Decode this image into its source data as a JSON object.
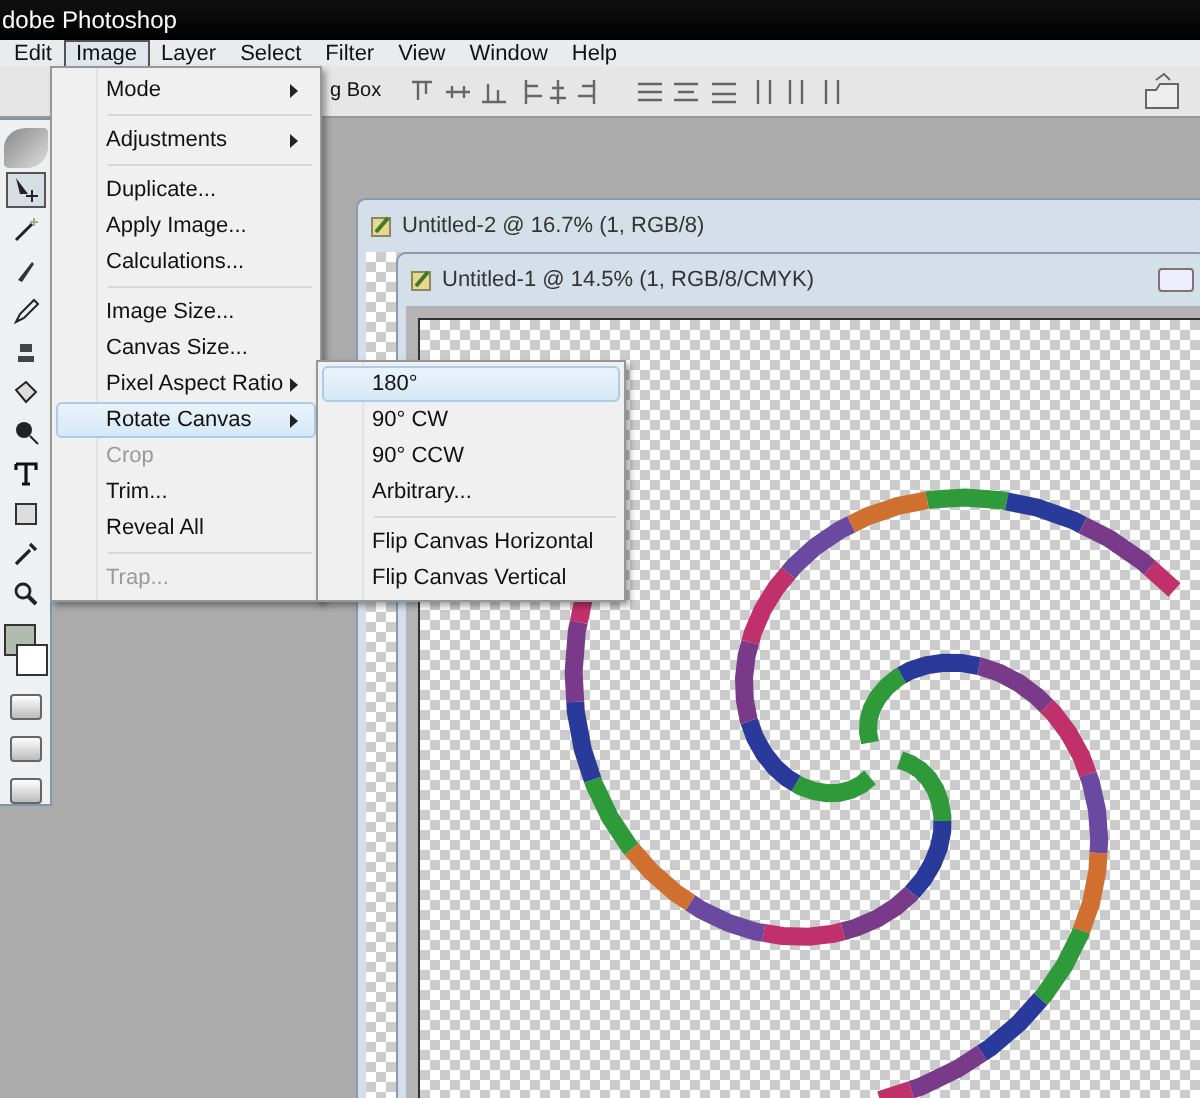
{
  "window": {
    "title": "dobe Photoshop"
  },
  "menubar": [
    {
      "label": "Edit",
      "selected": false
    },
    {
      "label": "Image",
      "selected": true
    },
    {
      "label": "Layer",
      "selected": false
    },
    {
      "label": "Select",
      "selected": false
    },
    {
      "label": "Filter",
      "selected": false
    },
    {
      "label": "View",
      "selected": false
    },
    {
      "label": "Window",
      "selected": false
    },
    {
      "label": "Help",
      "selected": false
    }
  ],
  "options_bar": {
    "label": "g Box"
  },
  "toolbox": [
    {
      "kind": "move",
      "selected": true
    },
    {
      "kind": "wand",
      "selected": false
    },
    {
      "kind": "brush",
      "selected": false
    },
    {
      "kind": "pencil",
      "selected": false
    },
    {
      "kind": "stamp",
      "selected": false
    },
    {
      "kind": "bucket",
      "selected": false
    },
    {
      "kind": "dodge",
      "selected": false
    },
    {
      "kind": "type",
      "selected": false
    },
    {
      "kind": "shape",
      "selected": false
    },
    {
      "kind": "eyedropper",
      "selected": false
    },
    {
      "kind": "zoom",
      "selected": false
    }
  ],
  "image_menu": [
    [
      {
        "label": "Mode",
        "submenu": true,
        "disabled": false,
        "selected": false
      }
    ],
    [
      {
        "label": "Adjustments",
        "submenu": true,
        "disabled": false,
        "selected": false
      }
    ],
    [
      {
        "label": "Duplicate...",
        "submenu": false,
        "disabled": false,
        "selected": false
      },
      {
        "label": "Apply Image...",
        "submenu": false,
        "disabled": false,
        "selected": false
      },
      {
        "label": "Calculations...",
        "submenu": false,
        "disabled": false,
        "selected": false
      }
    ],
    [
      {
        "label": "Image Size...",
        "submenu": false,
        "disabled": false,
        "selected": false
      },
      {
        "label": "Canvas Size...",
        "submenu": false,
        "disabled": false,
        "selected": false
      },
      {
        "label": "Pixel Aspect Ratio",
        "submenu": true,
        "disabled": false,
        "selected": false
      },
      {
        "label": "Rotate Canvas",
        "submenu": true,
        "disabled": false,
        "selected": true
      },
      {
        "label": "Crop",
        "submenu": false,
        "disabled": true,
        "selected": false
      },
      {
        "label": "Trim...",
        "submenu": false,
        "disabled": false,
        "selected": false
      },
      {
        "label": "Reveal All",
        "submenu": false,
        "disabled": false,
        "selected": false
      }
    ],
    [
      {
        "label": "Trap...",
        "submenu": false,
        "disabled": true,
        "selected": false
      }
    ]
  ],
  "rotate_submenu": [
    [
      {
        "label": "180°",
        "selected": true
      },
      {
        "label": "90° CW",
        "selected": false
      },
      {
        "label": "90° CCW",
        "selected": false
      },
      {
        "label": "Arbitrary...",
        "selected": false
      }
    ],
    [
      {
        "label": "Flip Canvas Horizontal",
        "selected": false
      },
      {
        "label": "Flip Canvas Vertical",
        "selected": false
      }
    ]
  ],
  "documents": [
    {
      "title": "Untitled-2 @ 16.7% (1, RGB/8)"
    },
    {
      "title": "Untitled-1 @ 14.5% (1, RGB/8/CMYK)"
    }
  ]
}
